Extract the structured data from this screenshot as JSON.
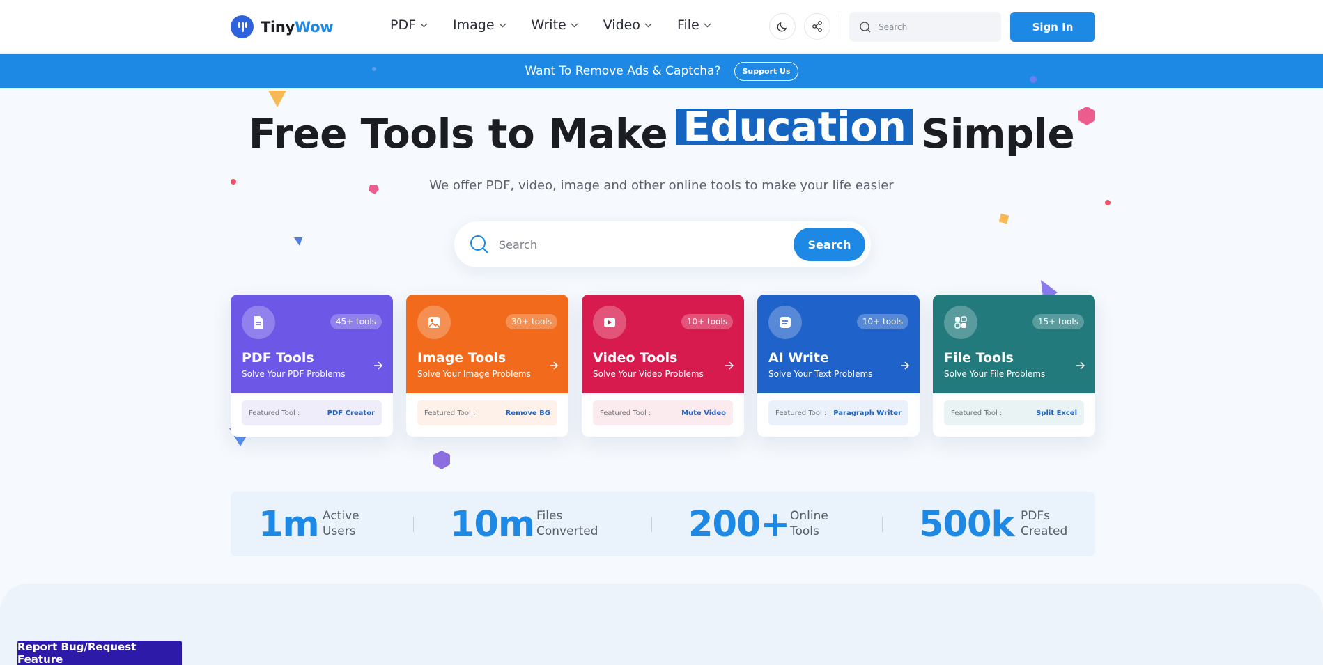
{
  "header": {
    "logo_part1": "Tiny",
    "logo_part2": "Wow",
    "nav": [
      {
        "label": "PDF"
      },
      {
        "label": "Image"
      },
      {
        "label": "Write"
      },
      {
        "label": "Video"
      },
      {
        "label": "File"
      }
    ],
    "search_placeholder": "Search",
    "signin_label": "Sign In"
  },
  "banner": {
    "text": "Want To Remove Ads & Captcha?",
    "button": "Support Us"
  },
  "hero": {
    "title_before": "Free Tools to Make",
    "title_highlight": "Education",
    "title_after": "Simple",
    "subtitle": "We offer PDF, video, image and other online tools to make your life easier",
    "search_placeholder": "Search",
    "search_button": "Search"
  },
  "cards": [
    {
      "title": "PDF Tools",
      "subtitle": "Solve Your PDF Problems",
      "count": "45+ tools",
      "featured_label": "Featured Tool :",
      "featured_tool": "PDF Creator",
      "color": "#6d57e6",
      "feat_bg": "#f0edfb",
      "icon": "pdf-icon"
    },
    {
      "title": "Image Tools",
      "subtitle": "Solve Your Image Problems",
      "count": "30+ tools",
      "featured_label": "Featured Tool :",
      "featured_tool": "Remove BG",
      "color": "#f26b1d",
      "feat_bg": "#fdf1ea",
      "icon": "image-icon"
    },
    {
      "title": "Video Tools",
      "subtitle": "Solve Your Video Problems",
      "count": "10+ tools",
      "featured_label": "Featured Tool :",
      "featured_tool": "Mute Video",
      "color": "#d81b4e",
      "feat_bg": "#fcebee",
      "icon": "video-icon"
    },
    {
      "title": "AI Write",
      "subtitle": "Solve Your Text Problems",
      "count": "10+ tools",
      "featured_label": "Featured Tool :",
      "featured_tool": "Paragraph Writer",
      "color": "#1f62c9",
      "feat_bg": "#eaf1fb",
      "icon": "write-icon"
    },
    {
      "title": "File Tools",
      "subtitle": "Solve Your File Problems",
      "count": "15+ tools",
      "featured_label": "Featured Tool :",
      "featured_tool": "Split Excel",
      "color": "#237a7c",
      "feat_bg": "#e9f3f3",
      "icon": "file-icon"
    }
  ],
  "stats": [
    {
      "value": "1m",
      "label1": "Active",
      "label2": "Users"
    },
    {
      "value": "10m",
      "label1": "Files",
      "label2": "Converted"
    },
    {
      "value": "200+",
      "label1": "Online",
      "label2": "Tools"
    },
    {
      "value": "500k",
      "label1": "PDFs",
      "label2": "Created"
    }
  ],
  "report_button": "Report Bug/Request Feature",
  "colors": {
    "accent": "#1e88e5",
    "highlight": "#1565c0",
    "report": "#2d1aa8"
  }
}
